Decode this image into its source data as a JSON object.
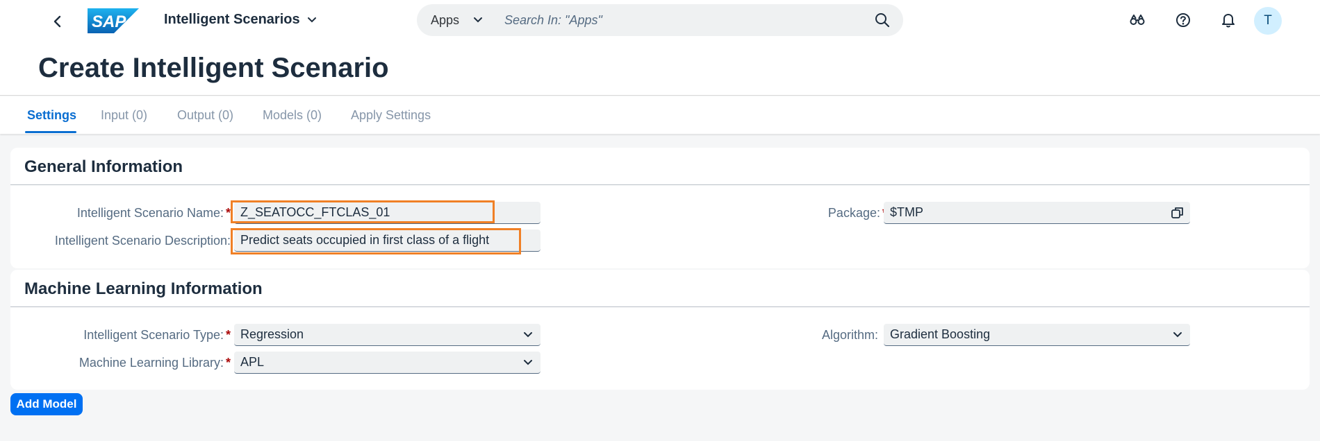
{
  "shell": {
    "brand": "SAP",
    "app_title": "Intelligent Scenarios",
    "search_scope": "Apps",
    "search_placeholder": "Search In: \"Apps\"",
    "avatar_initial": "T",
    "brand_color": "#0a6ed1"
  },
  "page": {
    "title": "Create Intelligent Scenario"
  },
  "tabs": [
    {
      "label": "Settings",
      "active": true
    },
    {
      "label": "Input (0)",
      "active": false
    },
    {
      "label": "Output (0)",
      "active": false
    },
    {
      "label": "Models (0)",
      "active": false
    },
    {
      "label": "Apply Settings",
      "active": false
    }
  ],
  "general": {
    "title": "General Information",
    "name_label": "Intelligent Scenario Name:",
    "name_value": "Z_SEATOCC_FTCLAS_01",
    "description_label": "Intelligent Scenario Description:",
    "description_value": "Predict seats occupied in first class of a flight",
    "package_label": "Package:",
    "package_value": "$TMP"
  },
  "ml": {
    "title": "Machine Learning Information",
    "type_label": "Intelligent Scenario Type:",
    "type_value": "Regression",
    "library_label": "Machine Learning Library:",
    "library_value": "APL",
    "algorithm_label": "Algorithm:",
    "algorithm_value": "Gradient Boosting"
  },
  "actions": {
    "add_model": "Add Model"
  },
  "colors": {
    "accent": "#0a6ed1",
    "button": "#0070f2",
    "highlight": "#f08026",
    "required": "#aa0808"
  },
  "icons": [
    "back-icon",
    "chevron-down-icon",
    "search-icon",
    "binoculars-icon",
    "help-icon",
    "bell-icon",
    "value-help-icon"
  ]
}
